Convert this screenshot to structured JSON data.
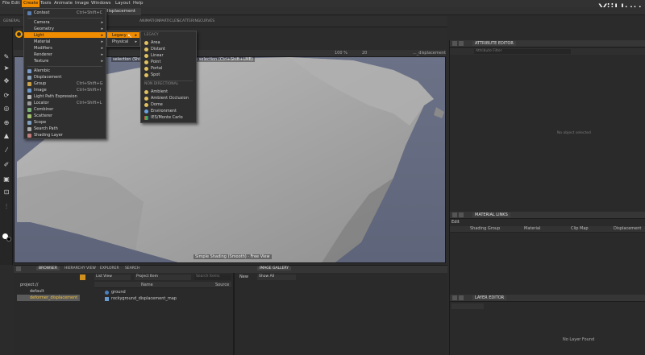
{
  "watermark": "YiiHuu",
  "menubar": [
    "File",
    "Edit",
    "Create",
    "Tools",
    "Animate",
    "Image",
    "Windows",
    "Layout",
    "Help"
  ],
  "document_tab": "displacement",
  "modebar": {
    "left": "GENERAL",
    "items": [
      "ANIMATION",
      "PARTICLES",
      "SCATTERING",
      "CURVES"
    ]
  },
  "viewport": {
    "zoom": "100 %",
    "frame": "20",
    "object": "..._displacement",
    "hint": "selection (Shift+LMB) · Remove item from selection (Ctrl+Shift+LMB)",
    "status": "Simple Shading (Smooth) · Free View"
  },
  "create_menu": {
    "items": [
      {
        "label": "Context",
        "shortcut": "Ctrl+Shift+C"
      },
      {
        "label": "Camera",
        "shortcut": ""
      },
      {
        "label": "Geometry",
        "shortcut": ""
      },
      {
        "label": "Light",
        "shortcut": ""
      },
      {
        "label": "Material",
        "shortcut": ""
      },
      {
        "label": "Modifiers",
        "shortcut": ""
      },
      {
        "label": "Renderer",
        "shortcut": ""
      },
      {
        "label": "Texture",
        "shortcut": ""
      },
      {
        "label": "Alembic",
        "shortcut": ""
      },
      {
        "label": "Displacement",
        "shortcut": ""
      },
      {
        "label": "Group",
        "shortcut": "Ctrl+Shift+G"
      },
      {
        "label": "Image",
        "shortcut": "Ctrl+Shift+I"
      },
      {
        "label": "Light Path Expression",
        "shortcut": ""
      },
      {
        "label": "Locator",
        "shortcut": "Ctrl+Shift+L"
      },
      {
        "label": "Combiner",
        "shortcut": ""
      },
      {
        "label": "Scatterer",
        "shortcut": ""
      },
      {
        "label": "Scope",
        "shortcut": ""
      },
      {
        "label": "Search Path",
        "shortcut": ""
      },
      {
        "label": "Shading Layer",
        "shortcut": ""
      }
    ]
  },
  "light_submenu": {
    "items": [
      "Legacy",
      "Physical"
    ]
  },
  "legacy_submenu": {
    "header1": "LEGACY",
    "items1": [
      "Area",
      "Distant",
      "Linear",
      "Point",
      "Portal",
      "Spot"
    ],
    "header2": "NON DIRECTIONAL",
    "items2": [
      "Ambient",
      "Ambient Occlusion",
      "Dome",
      "Environment",
      "IES/Monte Carlo"
    ]
  },
  "attribute_editor": {
    "title": "ATTRIBUTE EDITOR",
    "filter_placeholder": "Attribute Filter",
    "empty": "No object selected"
  },
  "material_links": {
    "title": "MATERIAL LINKS",
    "edit": "Edit",
    "columns": [
      "Shading Group",
      "Material",
      "Clip Map",
      "Displacement"
    ]
  },
  "layer_editor": {
    "title": "LAYER EDITOR",
    "empty": "No Layer Found"
  },
  "browser": {
    "tabs": [
      "BROWSER",
      "HIERARCHY VIEW",
      "EXPLORER",
      "SEARCH"
    ],
    "view_mode": "List View",
    "filter": "Project Item",
    "search_placeholder": "Search Items",
    "tree": [
      "project://",
      "default",
      "deformer_displacement"
    ],
    "columns": [
      "Name",
      "Source"
    ],
    "rows": [
      "ground",
      "rockyground_displacement_map"
    ]
  },
  "image_gallery": {
    "title": "IMAGE GALLERY",
    "new": "New",
    "show": "Show All"
  }
}
